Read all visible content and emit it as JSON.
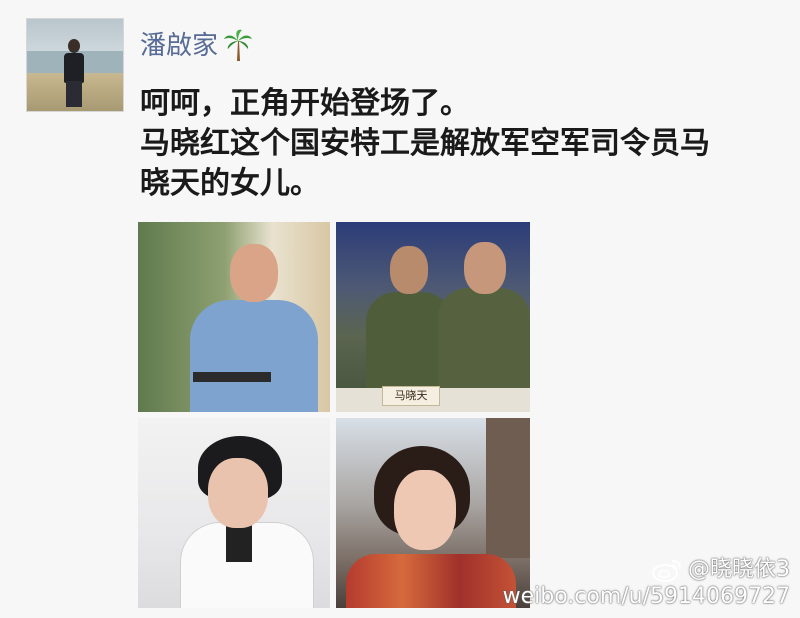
{
  "post": {
    "username": "潘啟家",
    "lines": [
      "呵呵，正角开始登场了。",
      "马晓红这个国安特工是解放军空军司令员马",
      "晓天的女儿。"
    ]
  },
  "photos": {
    "p2_nameplate": "马晓天"
  },
  "watermark": {
    "handle": "@晓晓依3",
    "url": "weibo.com/u/5914069727"
  },
  "icons": {
    "avatar": "avatar-photo",
    "username_emoji": "palm-tree-icon",
    "watermark_logo": "weibo-logo"
  },
  "colors": {
    "username": "#576b95",
    "text": "#1a1a1a",
    "background": "#f7f7f7"
  }
}
